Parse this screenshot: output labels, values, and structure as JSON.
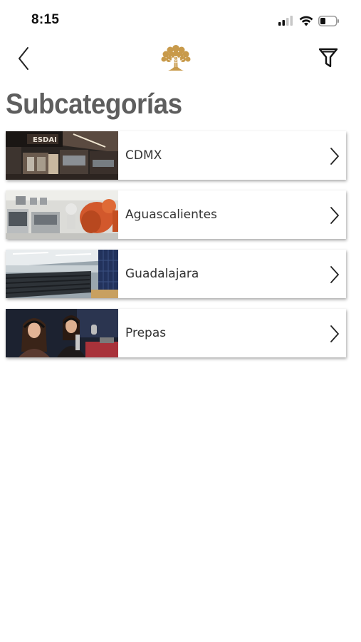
{
  "status": {
    "time": "8:15"
  },
  "nav": {
    "back_icon": "chevron-left-icon",
    "logo_icon": "tree-logo-icon",
    "filter_icon": "filter-funnel-icon",
    "accent": "#c89a4b"
  },
  "page": {
    "title": "Subcategorías"
  },
  "subcategories": [
    {
      "label": "CDMX",
      "image": "kitchen-classroom-photo"
    },
    {
      "label": "Aguascalientes",
      "image": "robot-arm-lab-photo"
    },
    {
      "label": "Guadalajara",
      "image": "auditorium-photo"
    },
    {
      "label": "Prepas",
      "image": "radio-studio-photo"
    }
  ]
}
